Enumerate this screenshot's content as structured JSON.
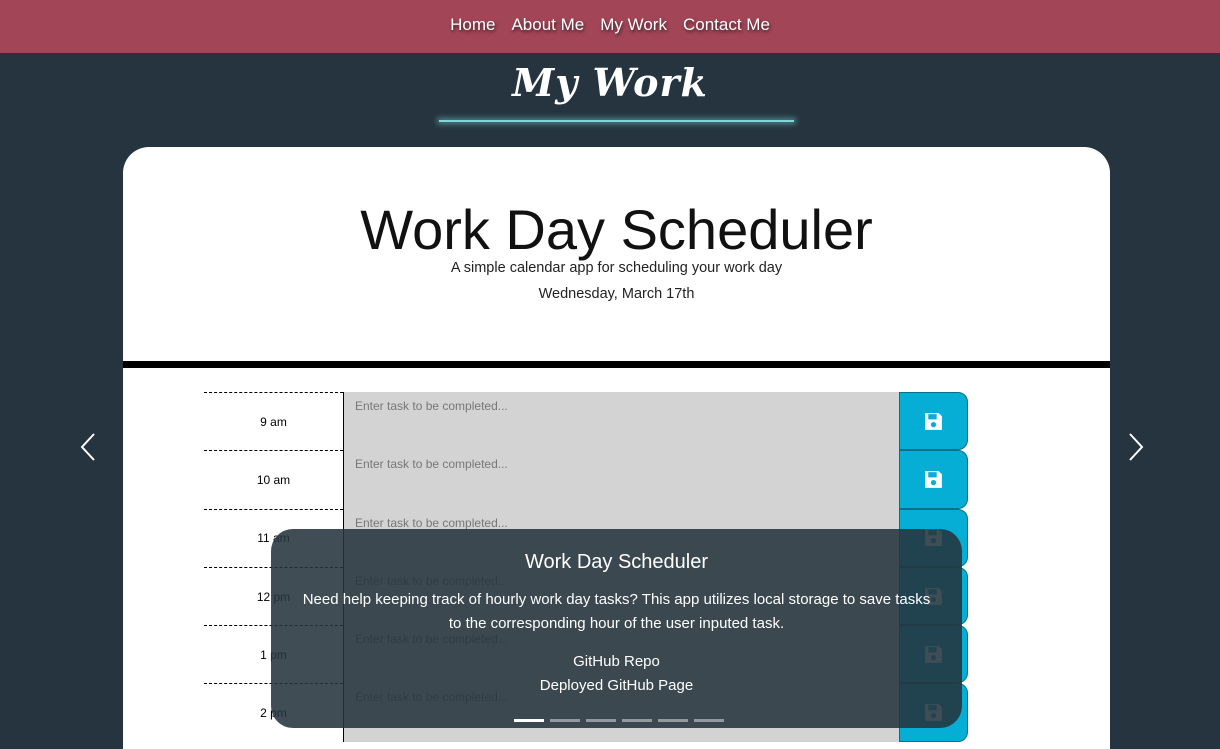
{
  "nav": {
    "items": [
      {
        "label": "Home"
      },
      {
        "label": "About Me"
      },
      {
        "label": "My Work"
      },
      {
        "label": "Contact Me"
      }
    ]
  },
  "page": {
    "title": "My Work"
  },
  "carousel": {
    "prev_icon": "chevron-left-icon",
    "next_icon": "chevron-right-icon",
    "slide": {
      "app_title": "Work Day Scheduler",
      "app_subtitle": "A simple calendar app for scheduling your work day",
      "app_date": "Wednesday, March 17th",
      "task_placeholder": "Enter task to be completed...",
      "rows": [
        {
          "hour": "9 am"
        },
        {
          "hour": "10 am"
        },
        {
          "hour": "11 am"
        },
        {
          "hour": "12 pm"
        },
        {
          "hour": "1 pm"
        },
        {
          "hour": "2 pm"
        }
      ]
    },
    "caption": {
      "title": "Work Day Scheduler",
      "description": "Need help keeping track of hourly work day tasks? This app utilizes local storage to save tasks to the corresponding hour of the user inputed task.",
      "repo_link": "GitHub Repo",
      "deploy_link": "Deployed GitHub Page"
    },
    "indicators": {
      "count": 6,
      "active_index": 0
    }
  },
  "colors": {
    "navbar": "#a24557",
    "background": "#25343e",
    "save_button": "#06aed5",
    "task_field": "#d3d3d3"
  }
}
